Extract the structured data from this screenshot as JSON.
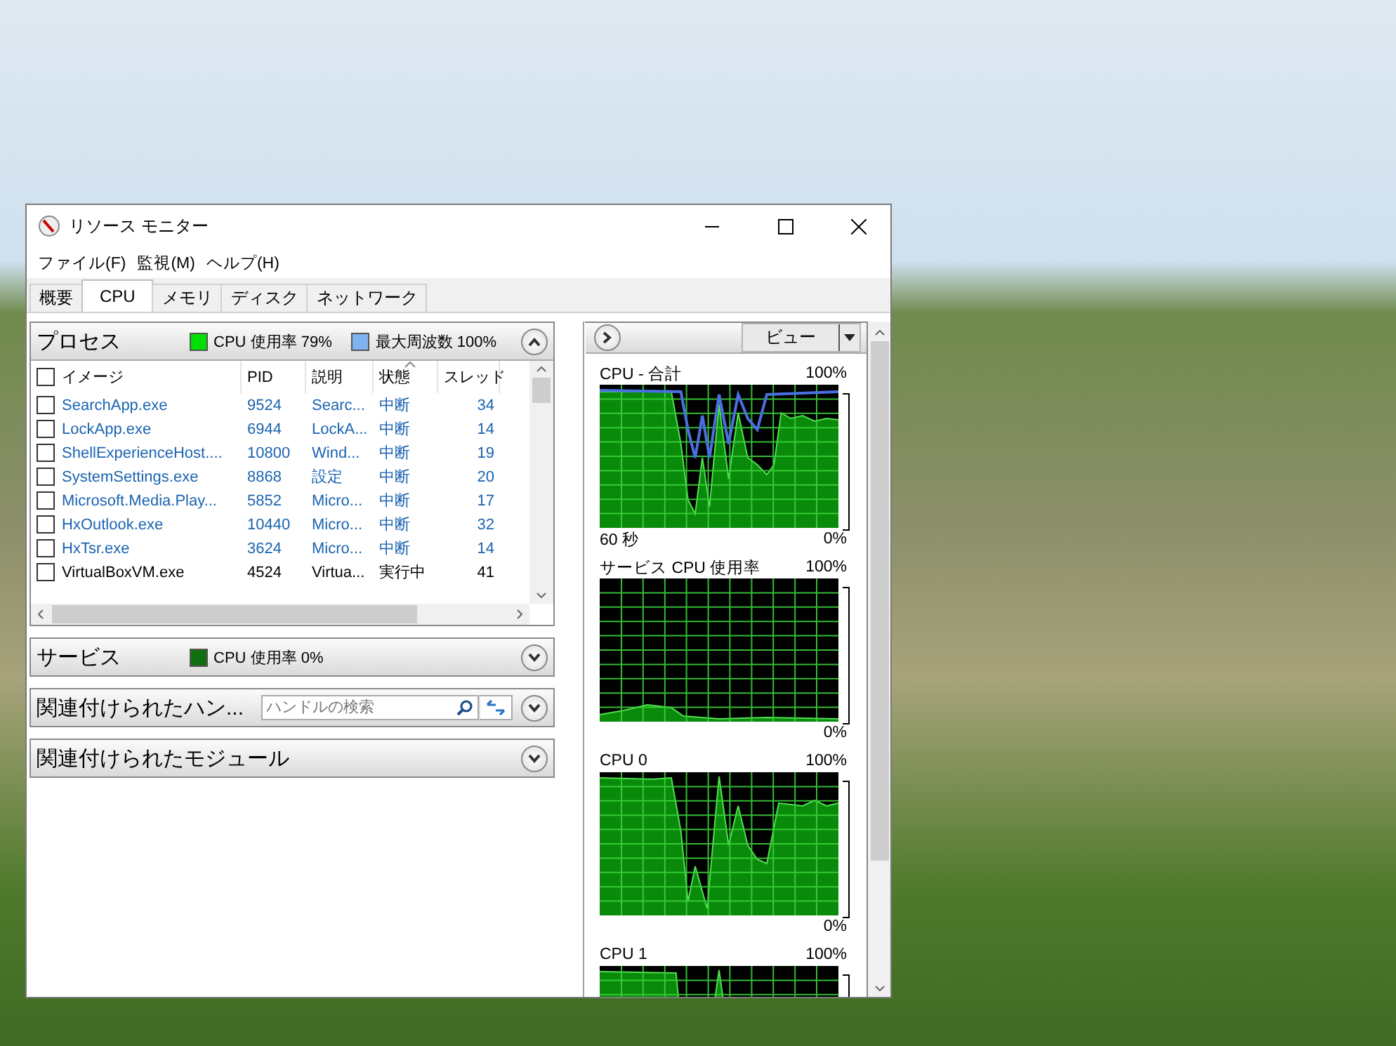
{
  "window": {
    "title": "リソース モニター"
  },
  "menu": [
    "ファイル(F)",
    "監視(M)",
    "ヘルプ(H)"
  ],
  "tabs": [
    {
      "label": "概要",
      "selected": false
    },
    {
      "label": "CPU",
      "selected": true
    },
    {
      "label": "メモリ",
      "selected": false
    },
    {
      "label": "ディスク",
      "selected": false
    },
    {
      "label": "ネットワーク",
      "selected": false
    }
  ],
  "processes": {
    "title": "プロセス",
    "expanded": true,
    "select_all_checked": false,
    "legend": [
      {
        "label": "CPU 使用率 79%",
        "color": "#00e000"
      },
      {
        "label": "最大周波数 100%",
        "color": "#7fb2f0"
      }
    ],
    "columns": [
      {
        "label": "イメージ",
        "sorted": false
      },
      {
        "label": "PID",
        "sorted": false
      },
      {
        "label": "説明",
        "sorted": false
      },
      {
        "label": "状態",
        "sorted": true
      },
      {
        "label": "スレッド",
        "sorted": false
      }
    ],
    "rows": [
      {
        "checked": false,
        "suspended": true,
        "cells": [
          "SearchApp.exe",
          "9524",
          "Searc...",
          "中断",
          "34"
        ]
      },
      {
        "checked": false,
        "suspended": true,
        "cells": [
          "LockApp.exe",
          "6944",
          "LockA...",
          "中断",
          "14"
        ]
      },
      {
        "checked": false,
        "suspended": true,
        "cells": [
          "ShellExperienceHost....",
          "10800",
          "Wind...",
          "中断",
          "19"
        ]
      },
      {
        "checked": false,
        "suspended": true,
        "cells": [
          "SystemSettings.exe",
          "8868",
          "設定",
          "中断",
          "20"
        ]
      },
      {
        "checked": false,
        "suspended": true,
        "cells": [
          "Microsoft.Media.Play...",
          "5852",
          "Micro...",
          "中断",
          "17"
        ]
      },
      {
        "checked": false,
        "suspended": true,
        "cells": [
          "HxOutlook.exe",
          "10440",
          "Micro...",
          "中断",
          "32"
        ]
      },
      {
        "checked": false,
        "suspended": true,
        "cells": [
          "HxTsr.exe",
          "3624",
          "Micro...",
          "中断",
          "14"
        ]
      },
      {
        "checked": false,
        "suspended": false,
        "cells": [
          "VirtualBoxVM.exe",
          "4524",
          "Virtua...",
          "実行中",
          "41"
        ]
      }
    ]
  },
  "services": {
    "title": "サービス",
    "expanded": false,
    "legend": [
      {
        "label": "CPU 使用率 0%",
        "color": "#107010"
      }
    ]
  },
  "handles": {
    "title": "関連付けられたハン...",
    "expanded": false,
    "search": {
      "placeholder": "ハンドルの検索"
    }
  },
  "modules": {
    "title": "関連付けられたモジュール",
    "expanded": false
  },
  "graph_panel": {
    "view_button": "ビュー",
    "graphs": [
      {
        "title": "CPU - 合計",
        "max_label": "100%",
        "min_label": "0%",
        "time_label": "60 秒"
      },
      {
        "title": "サービス CPU 使用率",
        "max_label": "100%",
        "min_label": "0%"
      },
      {
        "title": "CPU 0",
        "max_label": "100%",
        "min_label": "0%"
      },
      {
        "title": "CPU 1",
        "max_label": "100%"
      }
    ]
  }
}
